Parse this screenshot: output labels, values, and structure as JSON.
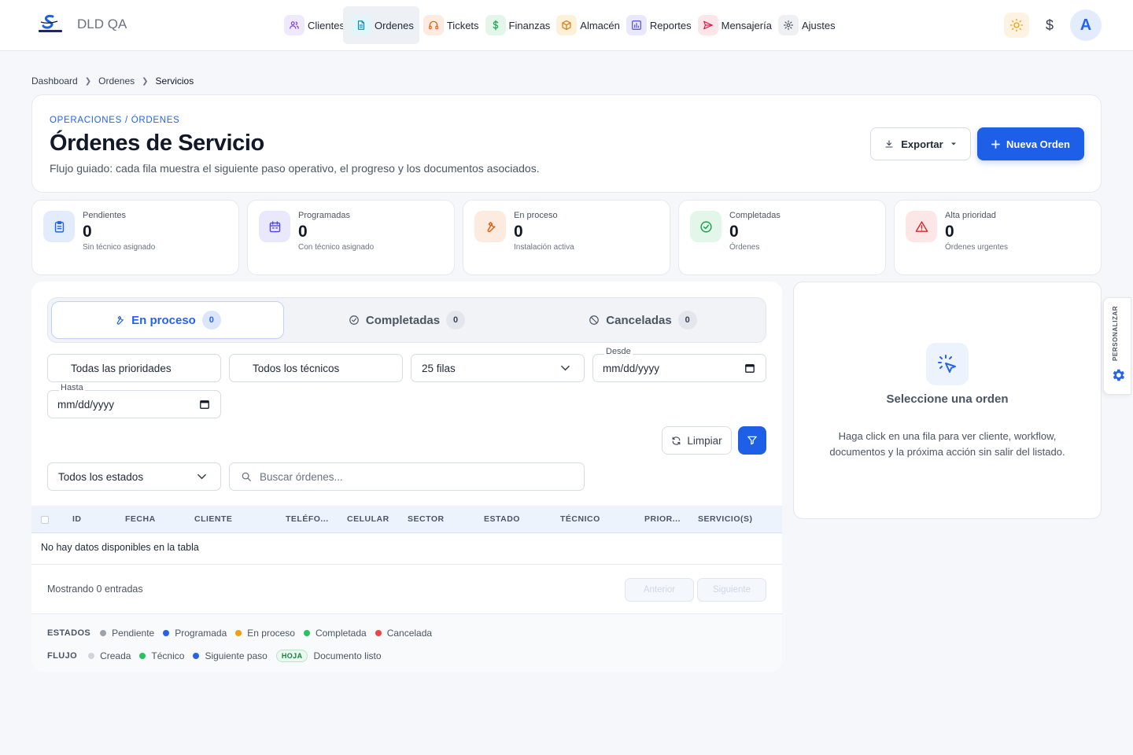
{
  "app": {
    "name": "DLD QA"
  },
  "nav": {
    "items": [
      {
        "label": "Clientes",
        "icon": "users-icon",
        "color": "#7c3aed",
        "bg": "#efe9fc"
      },
      {
        "label": "Ordenes",
        "icon": "document-icon",
        "color": "#0891b2",
        "bg": "#e2f6fa"
      },
      {
        "label": "Tickets",
        "icon": "headset-icon",
        "color": "#ea580c",
        "bg": "#fdebdf"
      },
      {
        "label": "Finanzas",
        "icon": "dollar-icon",
        "color": "#16a34a",
        "bg": "#e3f6e9"
      },
      {
        "label": "Almacén",
        "icon": "box-icon",
        "color": "#d97706",
        "bg": "#fdf1d9"
      },
      {
        "label": "Reportes",
        "icon": "chart-icon",
        "color": "#4f46e5",
        "bg": "#e9e8fc"
      },
      {
        "label": "Mensajería",
        "icon": "send-icon",
        "color": "#e11d48",
        "bg": "#fde6ea"
      },
      {
        "label": "Ajustes",
        "icon": "gear-icon",
        "color": "#4b5563",
        "bg": "#eef0f4"
      }
    ],
    "active": "Ordenes"
  },
  "topright": {
    "currency_symbol": "$",
    "avatar_initial": "A"
  },
  "breadcrumb": {
    "items": [
      "Dashboard",
      "Ordenes",
      "Servicios"
    ]
  },
  "header": {
    "eyebrow": "OPERACIONES / ÓRDENES",
    "title": "Órdenes de Servicio",
    "subtitle": "Flujo guiado: cada fila muestra el siguiente paso operativo, el progreso y los documentos asociados.",
    "export_label": "Exportar",
    "new_label": "Nueva Orden",
    "accent": "#1d5fe6"
  },
  "stats": [
    {
      "label": "Pendientes",
      "value": "0",
      "sub": "Sin técnico asignado",
      "icon": "clipboard-icon",
      "color": "#2563eb",
      "bg": "#e3ecfd"
    },
    {
      "label": "Programadas",
      "value": "0",
      "sub": "Con técnico asignado",
      "icon": "calendar-icon",
      "color": "#4f46e5",
      "bg": "#e9e8fc"
    },
    {
      "label": "En proceso",
      "value": "0",
      "sub": "Instalación activa",
      "icon": "wrench-icon",
      "color": "#ea580c",
      "bg": "#fdebdf"
    },
    {
      "label": "Completadas",
      "value": "0",
      "sub": "Órdenes",
      "icon": "check-circle-icon",
      "color": "#16a34a",
      "bg": "#e3f6e9"
    },
    {
      "label": "Alta prioridad",
      "value": "0",
      "sub": "Órdenes urgentes",
      "icon": "alert-icon",
      "color": "#dc2626",
      "bg": "#fde6e6"
    }
  ],
  "tabs": [
    {
      "label": "En proceso",
      "count": "0",
      "icon": "wrench-icon"
    },
    {
      "label": "Completadas",
      "count": "0",
      "icon": "check-circle-icon"
    },
    {
      "label": "Canceladas",
      "count": "0",
      "icon": "ban-icon"
    }
  ],
  "filters": {
    "priority": "Todas las prioridades",
    "technician": "Todos los técnicos",
    "rows": "25 filas",
    "desde_label": "Desde",
    "desde_value": "mm/dd/yyyy",
    "hasta_label": "Hasta",
    "hasta_value": "mm/dd/yyyy",
    "clear_label": "Limpiar",
    "status": "Todos los estados",
    "search_placeholder": "Buscar órdenes..."
  },
  "table": {
    "columns": [
      "ID",
      "FECHA",
      "CLIENTE",
      "TELÉFO...",
      "CELULAR",
      "SECTOR",
      "ESTADO",
      "TÉCNICO",
      "PRIOR...",
      "SERVICIO(S)"
    ],
    "empty_text": "No hay datos disponibles en la tabla",
    "showing": "Mostrando 0 entradas",
    "prev": "Anterior",
    "next": "Siguiente"
  },
  "legend": {
    "estados_title": "ESTADOS",
    "estados": [
      {
        "label": "Pendiente",
        "color": "#9ca3af"
      },
      {
        "label": "Programada",
        "color": "#2563eb"
      },
      {
        "label": "En proceso",
        "color": "#f59e0b"
      },
      {
        "label": "Completada",
        "color": "#22c55e"
      },
      {
        "label": "Cancelada",
        "color": "#ef4444"
      }
    ],
    "flujo_title": "FLUJO",
    "flujo": [
      {
        "label": "Creada",
        "color": "#d1d5db"
      },
      {
        "label": "Técnico",
        "color": "#22c55e"
      },
      {
        "label": "Siguiente paso",
        "color": "#2563eb"
      }
    ],
    "hoja_pill": "HOJA",
    "doc_label": "Documento listo"
  },
  "side": {
    "title": "Seleccione una orden",
    "text": "Haga click en una fila para ver cliente, workflow, documentos y la próxima acción sin salir del listado."
  },
  "customize": {
    "label": "PERSONALIZAR"
  }
}
